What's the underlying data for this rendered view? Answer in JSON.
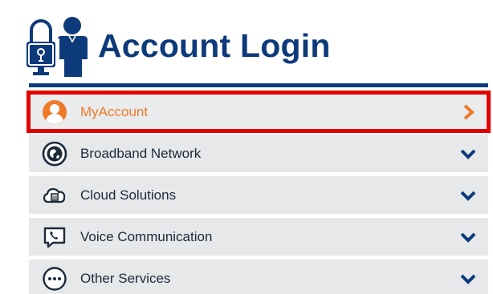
{
  "header": {
    "title": "Account Login",
    "icon": "lock-user-icon"
  },
  "menu": {
    "items": [
      {
        "label": "MyAccount",
        "icon": "user-icon",
        "indicator": "chevron-right-icon",
        "selected": true
      },
      {
        "label": "Broadband Network",
        "icon": "globe-icon",
        "indicator": "chevron-down-icon",
        "selected": false
      },
      {
        "label": "Cloud Solutions",
        "icon": "cloud-icon",
        "indicator": "chevron-down-icon",
        "selected": false
      },
      {
        "label": "Voice Communication",
        "icon": "phone-icon",
        "indicator": "chevron-down-icon",
        "selected": false
      },
      {
        "label": "Other Services",
        "icon": "more-icon",
        "indicator": "chevron-down-icon",
        "selected": false
      }
    ]
  },
  "colors": {
    "brand": "#0d3a7a",
    "accent": "#ee7a28",
    "highlight_border": "#e00000",
    "row_background": "#e6e8ea"
  }
}
